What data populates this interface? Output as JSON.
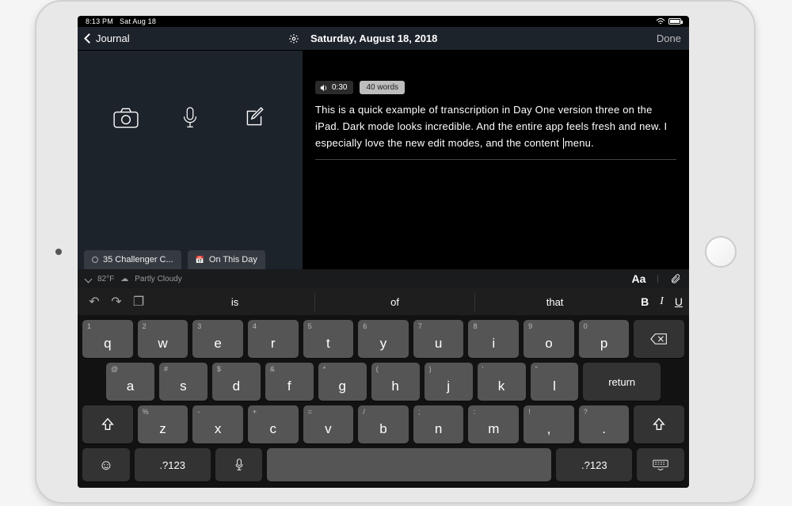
{
  "status_bar": {
    "time": "8:13 PM",
    "date": "Sat Aug 18"
  },
  "header": {
    "back_label": "Journal",
    "entry_date": "Saturday, August 18, 2018",
    "done_label": "Done"
  },
  "sidebar": {
    "chips": [
      {
        "label": "35 Challenger C..."
      },
      {
        "label": "On This Day"
      }
    ]
  },
  "editor": {
    "audio_duration": "0:30",
    "word_count_label": "40 words",
    "entry_text_a": "This is a quick example of transcription in Day One version three on the iPad. Dark mode looks incredible. And the entire app feels fresh and new. I especially love the new edit modes, and the content ",
    "entry_text_b": "menu."
  },
  "toolbar": {
    "temp": "82°F",
    "weather": "Partly Cloudy",
    "text_style_label": "Aa"
  },
  "quicktype": {
    "suggestions": [
      "is",
      "of",
      "that"
    ],
    "bold": "B",
    "italic": "I",
    "underline": "U"
  },
  "keyboard": {
    "row1": [
      {
        "main": "q",
        "alt": "1"
      },
      {
        "main": "w",
        "alt": "2"
      },
      {
        "main": "e",
        "alt": "3"
      },
      {
        "main": "r",
        "alt": "4"
      },
      {
        "main": "t",
        "alt": "5"
      },
      {
        "main": "y",
        "alt": "6"
      },
      {
        "main": "u",
        "alt": "7"
      },
      {
        "main": "i",
        "alt": "8"
      },
      {
        "main": "o",
        "alt": "9"
      },
      {
        "main": "p",
        "alt": "0"
      }
    ],
    "row2": [
      {
        "main": "a",
        "alt": "@"
      },
      {
        "main": "s",
        "alt": "#"
      },
      {
        "main": "d",
        "alt": "$"
      },
      {
        "main": "f",
        "alt": "&"
      },
      {
        "main": "g",
        "alt": "*"
      },
      {
        "main": "h",
        "alt": "("
      },
      {
        "main": "j",
        "alt": ")"
      },
      {
        "main": "k",
        "alt": "'"
      },
      {
        "main": "l",
        "alt": "\""
      }
    ],
    "row3": [
      {
        "main": "z",
        "alt": "%"
      },
      {
        "main": "x",
        "alt": "-"
      },
      {
        "main": "c",
        "alt": "+"
      },
      {
        "main": "v",
        "alt": "="
      },
      {
        "main": "b",
        "alt": "/"
      },
      {
        "main": "n",
        "alt": ";"
      },
      {
        "main": "m",
        "alt": ":"
      }
    ],
    "row3_right": [
      {
        "main": ",",
        "alt": "!"
      },
      {
        "main": ".",
        "alt": "?"
      }
    ],
    "return_label": "return",
    "numswitch_label": ".?123"
  }
}
